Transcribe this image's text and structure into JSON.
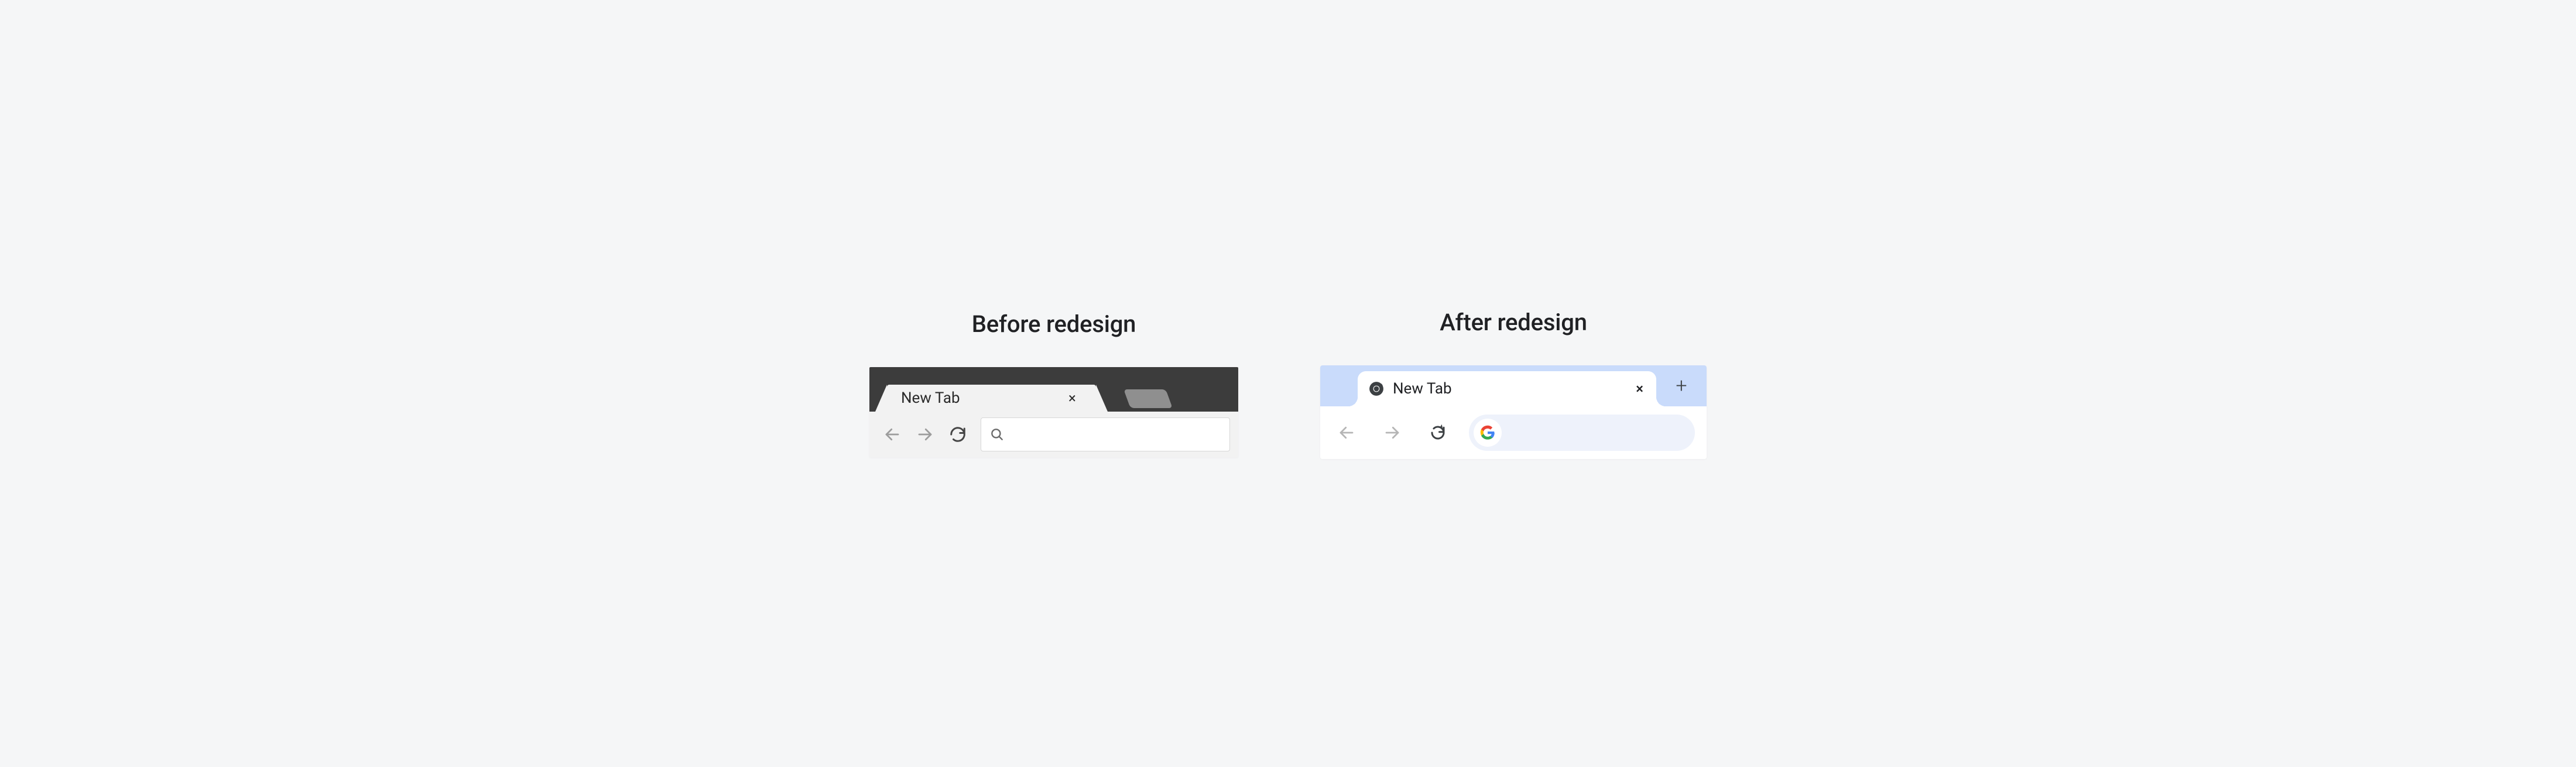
{
  "before": {
    "heading": "Before redesign",
    "tab_label": "New Tab",
    "close_glyph": "×",
    "colors": {
      "tabstrip": "#3c3c3c",
      "toolbar": "#f2f2f2",
      "newtab_button": "#8f8f8f"
    },
    "icons": {
      "back": "arrow-left-icon",
      "forward": "arrow-right-icon",
      "reload": "reload-icon",
      "search": "search-icon",
      "newtab": "new-tab-icon"
    }
  },
  "after": {
    "heading": "After redesign",
    "tab_label": "New Tab",
    "close_glyph": "×",
    "newtab_glyph": "+",
    "colors": {
      "tabstrip": "#c9dbfb",
      "toolbar": "#ffffff",
      "omnibox": "#eef2fb"
    },
    "icons": {
      "favicon_tab": "chrome-icon",
      "back": "arrow-left-icon",
      "forward": "arrow-right-icon",
      "reload": "reload-icon",
      "favicon_omnibox": "google-g-icon",
      "newtab": "plus-icon"
    }
  }
}
